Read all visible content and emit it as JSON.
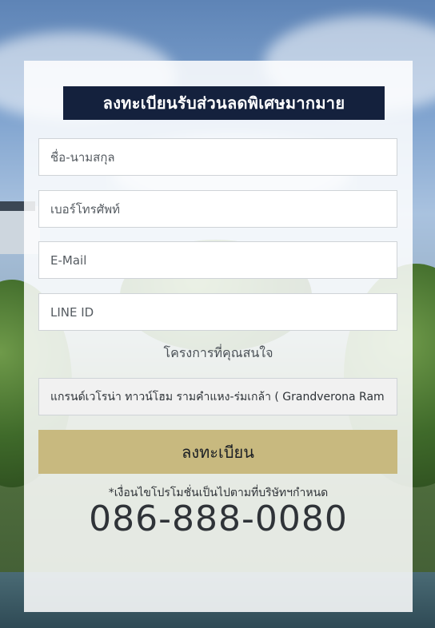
{
  "banner": {
    "title": "ลงทะเบียนรับส่วนลดพิเศษมากมาย"
  },
  "form": {
    "name_placeholder": "ชื่อ-นามสกุล",
    "phone_placeholder": "เบอร์โทรศัพท์",
    "email_placeholder": "E-Mail",
    "line_placeholder": "LINE ID",
    "project_label": "โครงการที่คุณสนใจ",
    "project_selected": "แกรนด์เวโรน่า ทาวน์โฮม รามคำแหง-ร่มเกล้า ( Grandverona Ram",
    "submit_label": "ลงทะเบียน"
  },
  "footer": {
    "note": "*เงื่อนไขโปรโมชั่นเป็นไปตามที่บริษัทฯกำหนด",
    "phone": "086-888-0080"
  },
  "colors": {
    "banner_bg": "#14213d",
    "submit_bg": "#c8b97f"
  }
}
